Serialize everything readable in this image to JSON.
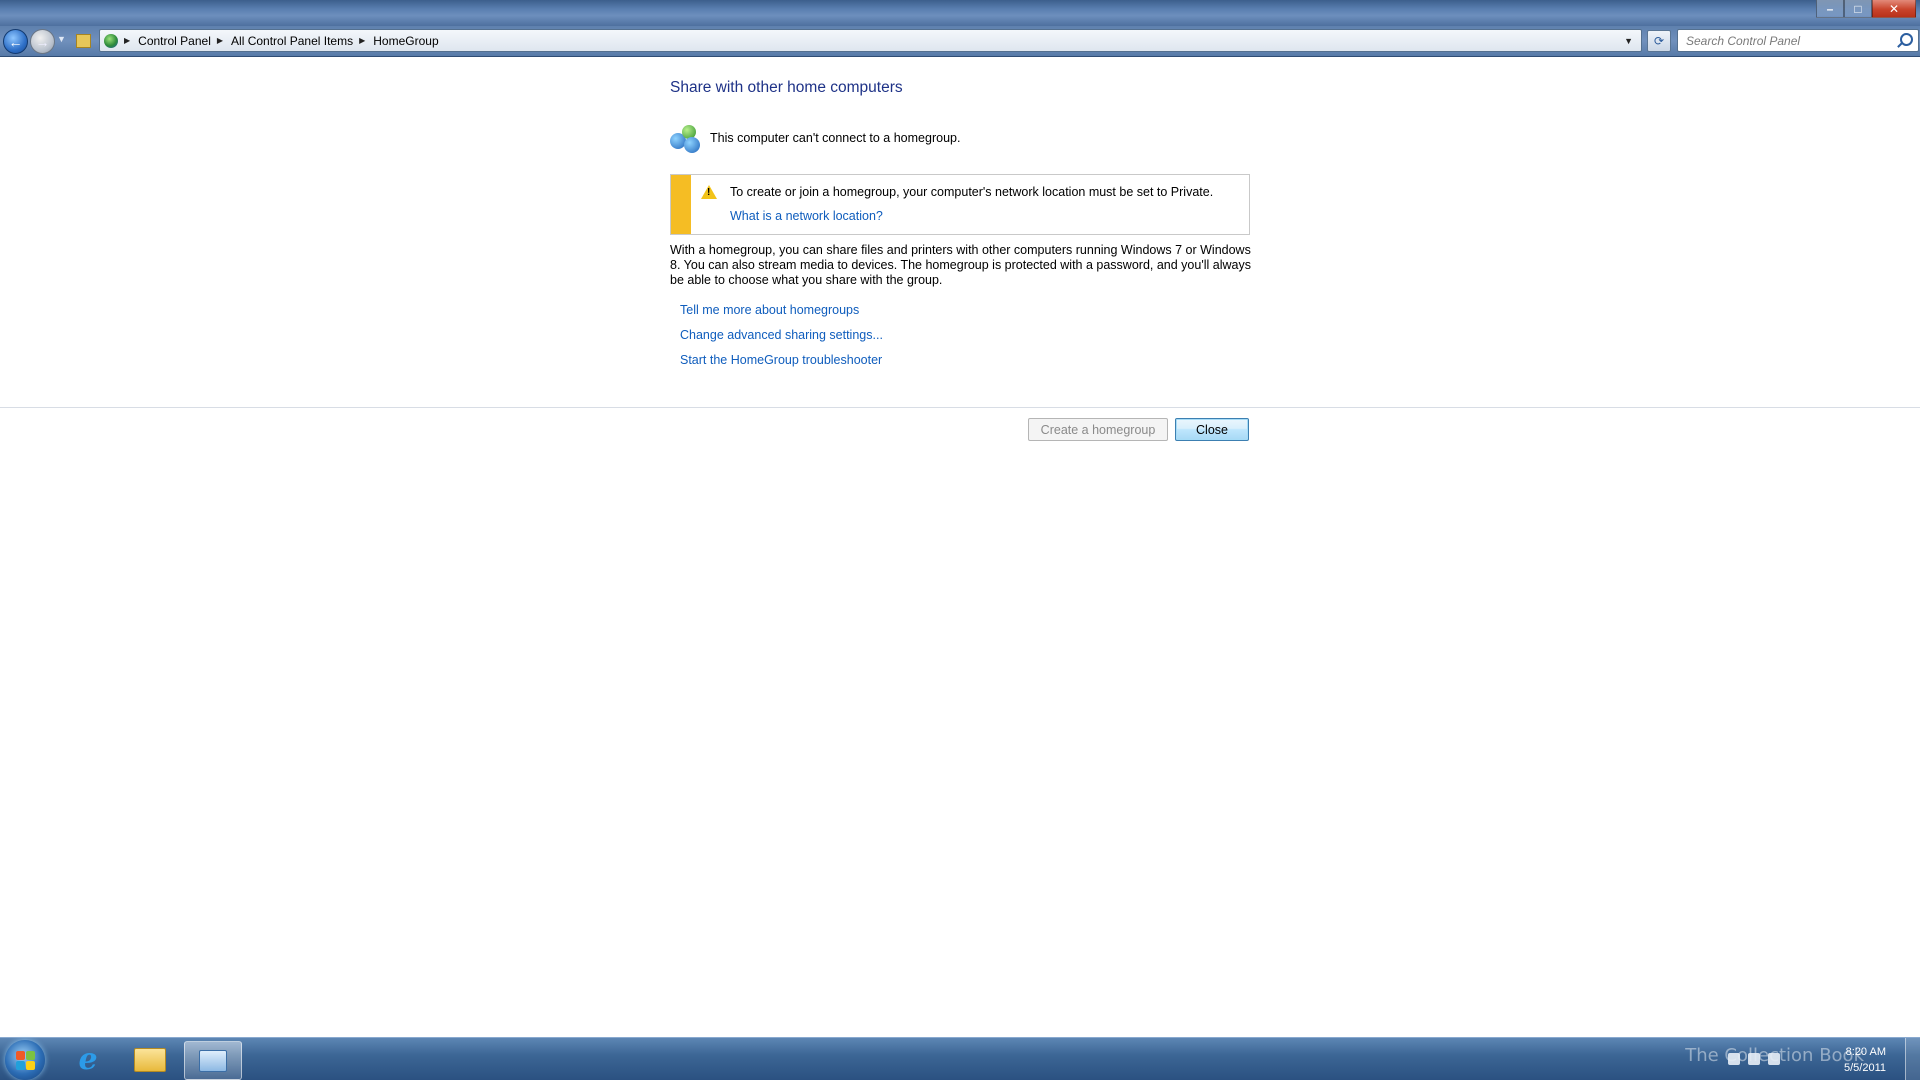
{
  "window": {
    "minimize_icon": "minimize-icon",
    "maximize_icon": "maximize-icon",
    "close_icon": "close-icon"
  },
  "nav": {
    "back_icon": "arrow-left-icon",
    "forward_icon": "arrow-right-icon",
    "refresh_icon": "refresh-icon"
  },
  "breadcrumb": [
    "Control Panel",
    "All Control Panel Items",
    "HomeGroup"
  ],
  "search": {
    "placeholder": "Search Control Panel"
  },
  "main": {
    "title": "Share with other home computers",
    "status_text": "This computer can't connect to a homegroup.",
    "warning": {
      "text": "To create or join a homegroup, your computer's network location must be set to Private.",
      "link": "What is a network location?"
    },
    "description": "With a homegroup, you can share files and printers with other computers running Windows 7 or Windows 8. You can also stream media to devices. The homegroup is protected with a password, and you'll always be able to choose what you share with the group.",
    "links": [
      "Tell me more about homegroups",
      "Change advanced sharing settings...",
      "Start the HomeGroup troubleshooter"
    ],
    "buttons": {
      "create": "Create a homegroup",
      "close": "Close"
    }
  },
  "taskbar": {
    "clock_time": "8:20 AM",
    "clock_date": "5/5/2011",
    "watermark": "The Collection Book"
  },
  "colors": {
    "title_blue": "#1e3287",
    "link_blue": "#0f5dbd",
    "warning_yellow": "#f5bd24",
    "taskbar": "#3c6695"
  }
}
